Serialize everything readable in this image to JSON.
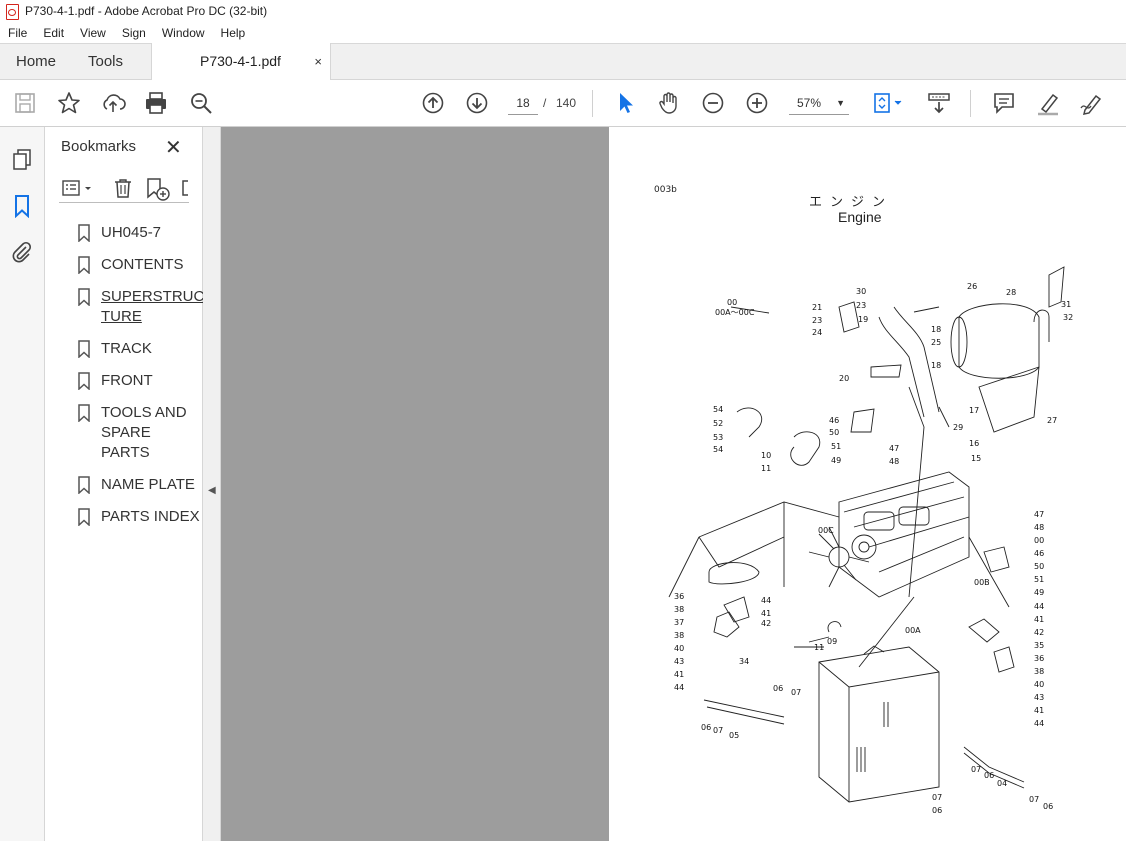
{
  "window": {
    "title": "P730-4-1.pdf - Adobe Acrobat Pro DC (32-bit)"
  },
  "menu": [
    "File",
    "Edit",
    "View",
    "Sign",
    "Window",
    "Help"
  ],
  "tabs": {
    "home": "Home",
    "tools": "Tools",
    "document": "P730-4-1.pdf",
    "close_glyph": "×"
  },
  "toolbar": {
    "current_page": "18",
    "page_separator": "/",
    "total_pages": "140",
    "zoom": "57%",
    "icons": [
      "save-icon",
      "bookmark-star-icon",
      "upload-icon",
      "print-icon",
      "zoom-search-icon",
      "prev-page-icon",
      "next-page-icon",
      "select-cursor-icon",
      "hand-icon",
      "zoom-out-icon",
      "zoom-in-icon",
      "fit-page-icon",
      "scroll-mode-icon",
      "comment-icon",
      "highlight-icon",
      "sign-icon"
    ]
  },
  "left_rail": {
    "icons": [
      "page-thumbnails-icon",
      "bookmarks-icon",
      "attachments-icon"
    ]
  },
  "bookmarks": {
    "title": "Bookmarks",
    "close_glyph": "✕",
    "items": [
      {
        "label": "UH045-7"
      },
      {
        "label": "CONTENTS"
      },
      {
        "label": "SUPERSTRUC TURE"
      },
      {
        "label": "TRACK"
      },
      {
        "label": "FRONT"
      },
      {
        "label": "TOOLS AND SPARE PARTS"
      },
      {
        "label": "NAME PLATE"
      },
      {
        "label": "PARTS INDEX"
      }
    ]
  },
  "page": {
    "code": "003b",
    "title_jp": "エンジン",
    "title_en": "Engine",
    "callouts_left": [
      "00",
      "00A～00C",
      "21",
      "23",
      "24",
      "30",
      "23",
      "19",
      "20",
      "54",
      "52",
      "53",
      "54",
      "46",
      "50",
      "51",
      "49",
      "10",
      "11",
      "36",
      "38",
      "37",
      "38",
      "40",
      "43",
      "41",
      "44",
      "06",
      "07",
      "05",
      "06",
      "07",
      "44",
      "41",
      "42",
      "34",
      "11",
      "09"
    ],
    "callouts_right": [
      "26",
      "28",
      "31",
      "32",
      "18",
      "25",
      "18",
      "17",
      "29",
      "27",
      "16",
      "15",
      "47",
      "48",
      "47",
      "48",
      "00",
      "46",
      "50",
      "51",
      "49",
      "44",
      "41",
      "42",
      "35",
      "36",
      "38",
      "40",
      "43",
      "41",
      "44",
      "00B",
      "00C",
      "00A",
      "07",
      "06",
      "04",
      "07",
      "06",
      "07",
      "06"
    ]
  }
}
